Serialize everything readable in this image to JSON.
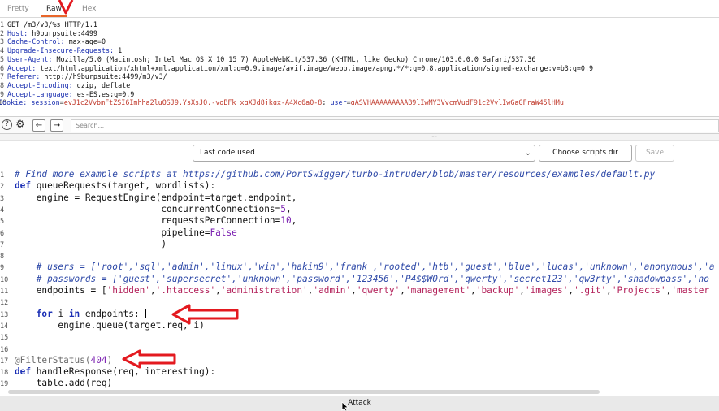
{
  "tabs": [
    {
      "label": "Pretty"
    },
    {
      "label": "Raw"
    },
    {
      "label": "Hex"
    }
  ],
  "request": {
    "lines": [
      {
        "num": "1",
        "key": "",
        "value": "GET /m3/v3/%s HTTP/1.1"
      },
      {
        "num": "2",
        "key": "Host:",
        "value": " h9burpsuite:4499"
      },
      {
        "num": "3",
        "key": "Cache-Control:",
        "value": " max-age=0"
      },
      {
        "num": "4",
        "key": "Upgrade-Insecure-Requests:",
        "value": " 1"
      },
      {
        "num": "5",
        "key": "User-Agent:",
        "value": " Mozilla/5.0 (Macintosh; Intel Mac OS X 10_15_7) AppleWebKit/537.36 (KHTML, like Gecko) Chrome/103.0.0.0 Safari/537.36"
      },
      {
        "num": "6",
        "key": "Accept:",
        "value": " text/html,application/xhtml+xml,application/xml;q=0.9,image/avif,image/webp,image/apng,*/*;q=0.8,application/signed-exchange;v=b3;q=0.9"
      },
      {
        "num": "7",
        "key": "Referer:",
        "value": " http://h9burpsuite:4499/m3/v3/"
      },
      {
        "num": "8",
        "key": "Accept-Encoding:",
        "value": " gzip, deflate"
      },
      {
        "num": "9",
        "key": "Accept-Language:",
        "value": " es-ES,es;q=0.9"
      }
    ],
    "cookie": {
      "num": "10",
      "key": "Cookie:",
      "session_key": "session",
      "session_val": "eyJ1c2VybmFtZSI6Imhha2luOSJ9.YsXsJQ.-yoBFk_xqXJd8jkqx-A4Xc6a0-8",
      "user_key": "user",
      "user_val": "gASVHAAAAAAAAAB9lIwMY3VycmVudF91c2VylIwGaGFraW45lHMu"
    }
  },
  "searchbar": {
    "help": "?",
    "settings": "⚙",
    "prev": "←",
    "next": "→",
    "placeholder": "Search..."
  },
  "scripts": {
    "selected": "Last code used",
    "choose_label": "Choose scripts dir",
    "save_label": "Save"
  },
  "code": {
    "lines": [
      {
        "num": "1",
        "tokens": [
          {
            "t": "cm",
            "v": "# Find more example scripts at https://github.com/PortSwigger/turbo-intruder/blob/master/resources/examples/default.py"
          }
        ]
      },
      {
        "num": "2",
        "tokens": [
          {
            "t": "kw",
            "v": "def"
          },
          {
            "t": "",
            "v": " queueRequests(target, wordlists):"
          }
        ]
      },
      {
        "num": "3",
        "tokens": [
          {
            "t": "",
            "v": "    engine = RequestEngine(endpoint=target.endpoint,"
          }
        ]
      },
      {
        "num": "4",
        "tokens": [
          {
            "t": "",
            "v": "                           concurrentConnections="
          },
          {
            "t": "num",
            "v": "5"
          },
          {
            "t": "",
            "v": ","
          }
        ]
      },
      {
        "num": "5",
        "tokens": [
          {
            "t": "",
            "v": "                           requestsPerConnection="
          },
          {
            "t": "num",
            "v": "10"
          },
          {
            "t": "",
            "v": ","
          }
        ]
      },
      {
        "num": "6",
        "tokens": [
          {
            "t": "",
            "v": "                           pipeline="
          },
          {
            "t": "bi",
            "v": "False"
          }
        ]
      },
      {
        "num": "7",
        "tokens": [
          {
            "t": "",
            "v": "                           )"
          }
        ]
      },
      {
        "num": "8",
        "tokens": [
          {
            "t": "",
            "v": ""
          }
        ]
      },
      {
        "num": "9",
        "tokens": [
          {
            "t": "cm",
            "v": "    # users = ['root','sql','admin','linux','win','hakin9','frank','rooted','htb','guest','blue','lucas','unknown','anonymous','a"
          }
        ]
      },
      {
        "num": "10",
        "tokens": [
          {
            "t": "cm",
            "v": "    # passwords = ['guest','supersecret','unknown','password','123456','P4$$W0rd','qwerty','secret123','qw3rty','shadowpass','no"
          }
        ]
      },
      {
        "num": "11",
        "tokens": [
          {
            "t": "",
            "v": "    endpoints = ["
          },
          {
            "t": "str",
            "v": "'hidden'"
          },
          {
            "t": "",
            "v": ","
          },
          {
            "t": "str",
            "v": "'.htaccess'"
          },
          {
            "t": "",
            "v": ","
          },
          {
            "t": "str",
            "v": "'administration'"
          },
          {
            "t": "",
            "v": ","
          },
          {
            "t": "str",
            "v": "'admin'"
          },
          {
            "t": "",
            "v": ","
          },
          {
            "t": "str",
            "v": "'qwerty'"
          },
          {
            "t": "",
            "v": ","
          },
          {
            "t": "str",
            "v": "'management'"
          },
          {
            "t": "",
            "v": ","
          },
          {
            "t": "str",
            "v": "'backup'"
          },
          {
            "t": "",
            "v": ","
          },
          {
            "t": "str",
            "v": "'images'"
          },
          {
            "t": "",
            "v": ","
          },
          {
            "t": "str",
            "v": "'.git'"
          },
          {
            "t": "",
            "v": ","
          },
          {
            "t": "str",
            "v": "'Projects'"
          },
          {
            "t": "",
            "v": ","
          },
          {
            "t": "str",
            "v": "'master"
          }
        ]
      },
      {
        "num": "12",
        "tokens": [
          {
            "t": "",
            "v": ""
          }
        ]
      },
      {
        "num": "13",
        "tokens": [
          {
            "t": "",
            "v": "    "
          },
          {
            "t": "kw",
            "v": "for"
          },
          {
            "t": "",
            "v": " i "
          },
          {
            "t": "kw",
            "v": "in"
          },
          {
            "t": "",
            "v": " endpoints: "
          }
        ],
        "caret": true
      },
      {
        "num": "14",
        "tokens": [
          {
            "t": "",
            "v": "        engine.queue(target.req, i)"
          }
        ]
      },
      {
        "num": "15",
        "tokens": [
          {
            "t": "",
            "v": ""
          }
        ]
      },
      {
        "num": "16",
        "tokens": [
          {
            "t": "",
            "v": ""
          }
        ]
      },
      {
        "num": "17",
        "tokens": [
          {
            "t": "dec",
            "v": "@FilterStatus("
          },
          {
            "t": "num",
            "v": "404"
          },
          {
            "t": "dec",
            "v": ")"
          }
        ]
      },
      {
        "num": "18",
        "tokens": [
          {
            "t": "kw",
            "v": "def"
          },
          {
            "t": "",
            "v": " handleResponse(req, interesting):"
          }
        ]
      },
      {
        "num": "19",
        "tokens": [
          {
            "t": "",
            "v": "    table.add(req)"
          }
        ]
      }
    ]
  },
  "attack_label": "Attack",
  "annotation_color": "#e3191f"
}
